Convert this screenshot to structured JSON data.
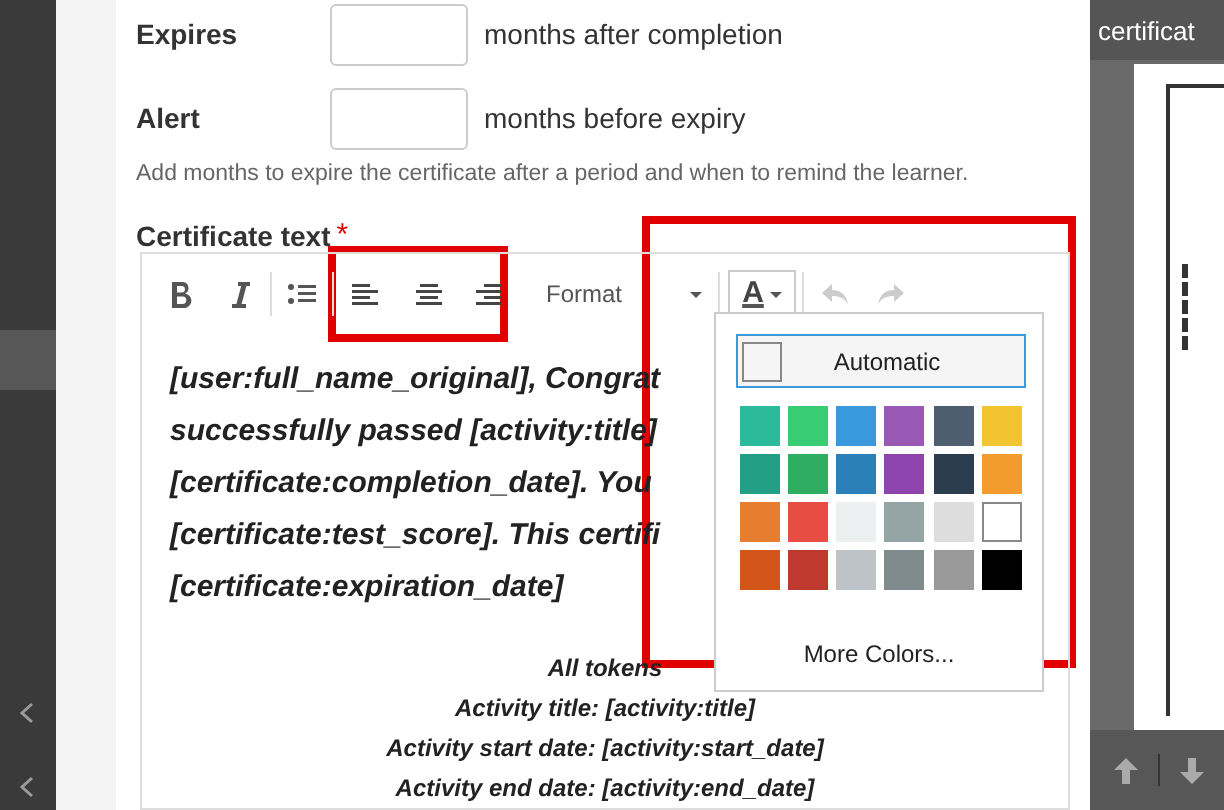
{
  "fields": [
    {
      "label": "Expires",
      "suffix": "months after completion"
    },
    {
      "label": "Alert",
      "suffix": "months before expiry"
    }
  ],
  "help": "Add months to expire the certificate after a period and when to remind the learner.",
  "certificate_text": {
    "label": "Certificate text",
    "required": "*"
  },
  "toolbar": {
    "format": "Format",
    "text_color": "A"
  },
  "body_lines": [
    "[user:full_name_original], Congrat",
    "successfully passed [activity:title]",
    "[certificate:completion_date]. You",
    "[certificate:test_score]. This certifi",
    "[certificate:expiration_date]"
  ],
  "tokens": [
    "All tokens",
    "Activity title: [activity:title]",
    "Activity start date: [activity:start_date]",
    "Activity end date: [activity:end_date]"
  ],
  "color_menu": {
    "automatic": {
      "label": "Automatic",
      "selected": true
    },
    "swatches": [
      {
        "color": "#2bbb9b",
        "selected": false
      },
      {
        "color": "#3acc73",
        "selected": false
      },
      {
        "color": "#3a98dc",
        "selected": false
      },
      {
        "color": "#9b59b6",
        "selected": false
      },
      {
        "color": "#4e5e70",
        "selected": false
      },
      {
        "color": "#f2c430",
        "selected": false
      },
      {
        "color": "#239f85",
        "selected": false
      },
      {
        "color": "#2fad60",
        "selected": false
      },
      {
        "color": "#2c80ba",
        "selected": false
      },
      {
        "color": "#8e44ad",
        "selected": false
      },
      {
        "color": "#2c3d50",
        "selected": false
      },
      {
        "color": "#f39c2e",
        "selected": false
      },
      {
        "color": "#e67e30",
        "selected": false
      },
      {
        "color": "#e74d42",
        "selected": false
      },
      {
        "color": "#ecf0f1",
        "selected": false
      },
      {
        "color": "#95a5a6",
        "selected": false
      },
      {
        "color": "#dddddd",
        "selected": false
      },
      {
        "color": "#ffffff",
        "selected": false
      },
      {
        "color": "#d35519",
        "selected": false
      },
      {
        "color": "#c0392e",
        "selected": false
      },
      {
        "color": "#bdc3c7",
        "selected": false
      },
      {
        "color": "#7f8c8d",
        "selected": false
      },
      {
        "color": "#999999",
        "selected": false
      },
      {
        "color": "#000000",
        "selected": false
      }
    ],
    "more": "More Colors..."
  },
  "preview": {
    "title": "certificat"
  }
}
